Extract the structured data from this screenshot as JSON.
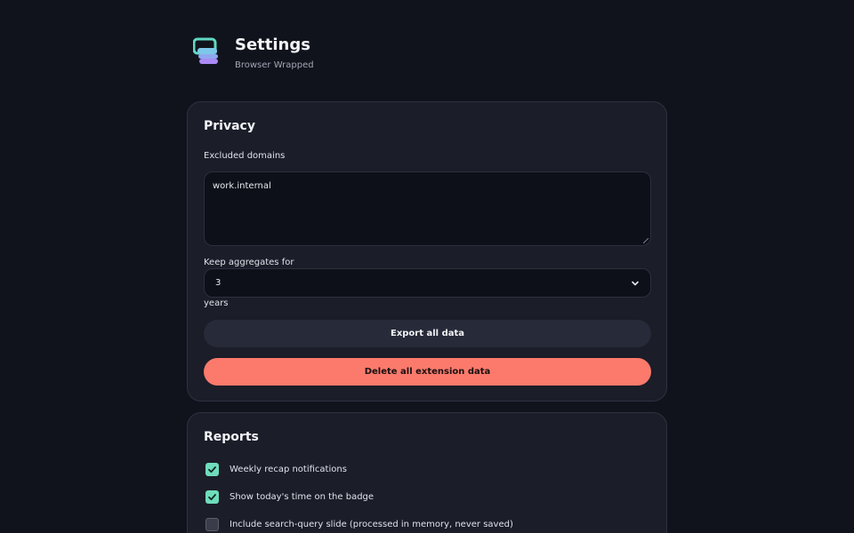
{
  "header": {
    "title": "Settings",
    "subtitle": "Browser Wrapped",
    "logo_icon": "stacked-cards-logo-icon",
    "logo_colors": {
      "top": "#5fd8c4",
      "bottom": "#a98af5"
    }
  },
  "privacy": {
    "title": "Privacy",
    "excluded_label": "Excluded domains",
    "excluded_value": "work.internal",
    "keep_label": "Keep aggregates for",
    "keep_value": "3",
    "keep_unit": "years",
    "export_label": "Export all data",
    "delete_label": "Delete all extension data"
  },
  "reports": {
    "title": "Reports",
    "options": [
      {
        "label": "Weekly recap notifications",
        "checked": true
      },
      {
        "label": "Show today's time on the badge",
        "checked": true
      },
      {
        "label": "Include search-query slide (processed in memory, never saved)",
        "checked": false
      }
    ]
  },
  "colors": {
    "background": "#11131c",
    "card": "#1b1d28",
    "accent_check": "#6fdcbb",
    "danger": "#fb7a6c"
  }
}
